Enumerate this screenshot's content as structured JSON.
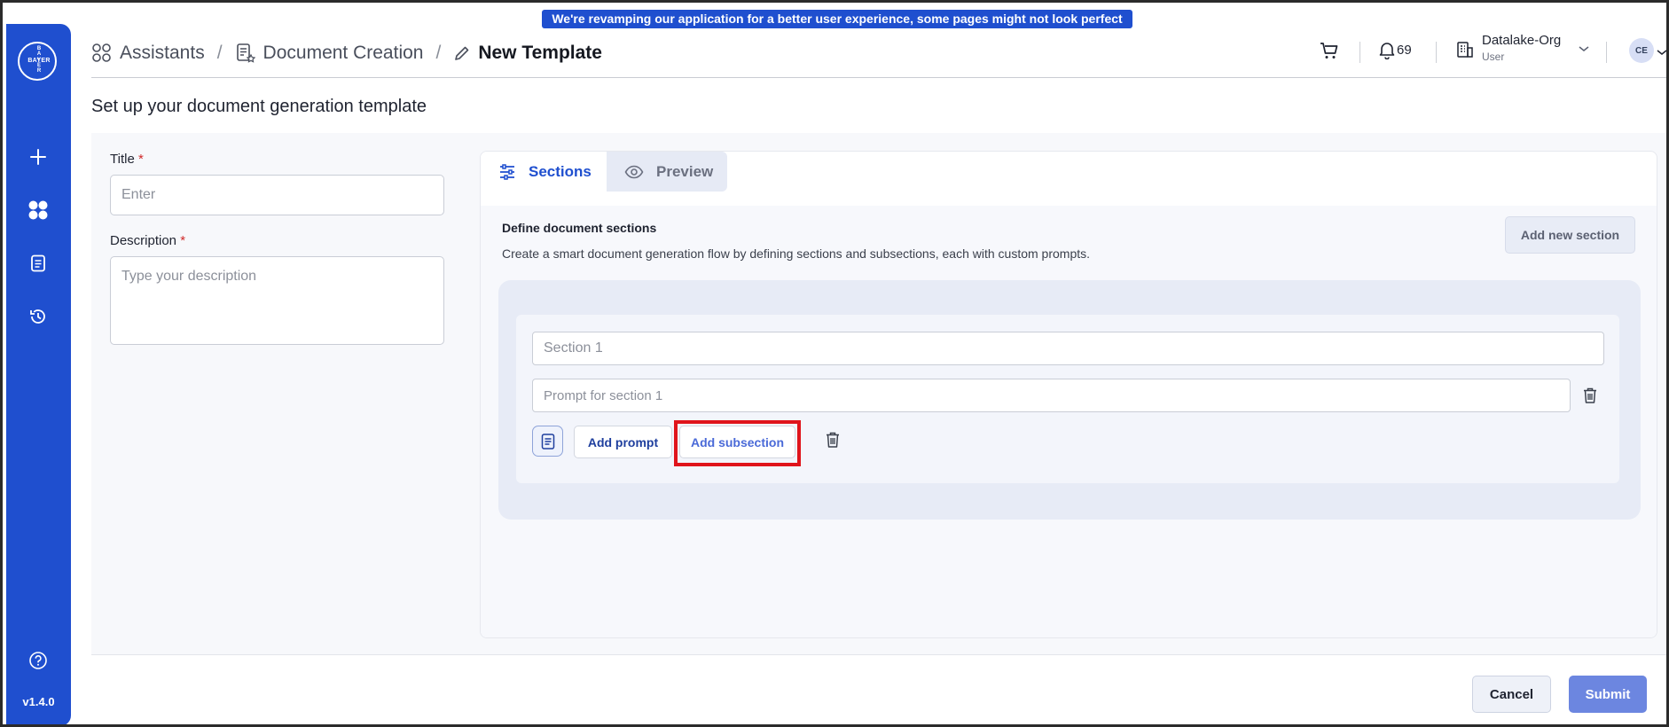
{
  "banner": "We're revamping our application for a better user experience, some pages might not look perfect yet!",
  "sidebar": {
    "logo_vertical": "BAYER",
    "logo_horizontal": "BAYER",
    "icons": [
      "plus-icon",
      "apps-grid-icon",
      "document-icon",
      "history-icon",
      "help-icon"
    ],
    "version": "v1.4.0"
  },
  "header": {
    "breadcrumb": {
      "item1": "Assistants",
      "item2": "Document Creation",
      "current": "New Template",
      "separator": "/"
    },
    "notifications_count": "69",
    "org_name": "Datalake-Org",
    "org_role": "User",
    "avatar_initials": "CE"
  },
  "page": {
    "title": "Set up your document generation template"
  },
  "form": {
    "title_label": "Title",
    "title_placeholder": "Enter",
    "description_label": "Description",
    "description_placeholder": "Type your description",
    "required_marker": "*"
  },
  "tabs": [
    {
      "label": "Sections",
      "icon": "sliders-icon",
      "active": true
    },
    {
      "label": "Preview",
      "icon": "eye-icon",
      "active": false
    }
  ],
  "sections": {
    "heading": "Define document sections",
    "description": "Create a smart document generation flow by defining sections and subsections, each with custom prompts.",
    "add_new_label": "Add new section",
    "items": [
      {
        "title_placeholder": "Section 1",
        "prompt_placeholder": "Prompt for section 1",
        "add_prompt_label": "Add prompt",
        "add_subsection_label": "Add subsection"
      }
    ]
  },
  "footer": {
    "cancel_label": "Cancel",
    "submit_label": "Submit"
  },
  "colors": {
    "primary": "#1f4fcf",
    "submit": "#6c86e0",
    "highlight": "#e0141b",
    "required": "#d02a2a"
  }
}
